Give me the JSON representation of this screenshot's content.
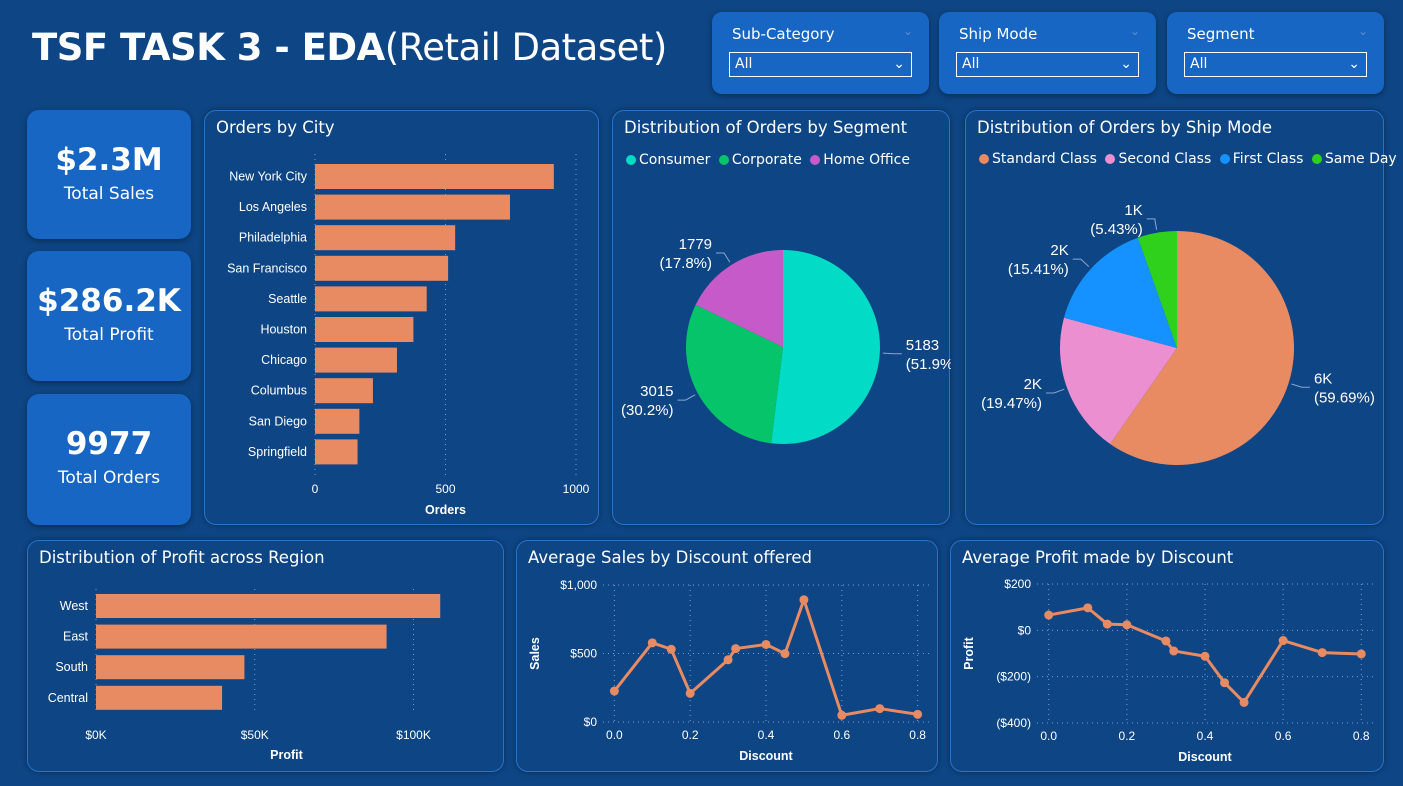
{
  "header": {
    "title_bold": "TSF TASK 3 - EDA",
    "title_light": "(Retail Dataset)"
  },
  "slicers": [
    {
      "label": "Sub-Category",
      "value": "All"
    },
    {
      "label": "Ship Mode",
      "value": "All"
    },
    {
      "label": "Segment",
      "value": "All"
    }
  ],
  "kpis": [
    {
      "value": "$2.3M",
      "label": "Total Sales"
    },
    {
      "value": "$286.2K",
      "label": "Total Profit"
    },
    {
      "value": "9977",
      "label": "Total Orders"
    }
  ],
  "colors": {
    "bar": "#e98b62",
    "background": "#0e4584",
    "card": "#1766c3",
    "consumer": "#02dcc7",
    "corporate": "#05c46a",
    "home_office": "#c65ac8",
    "standard_class": "#e98b62",
    "second_class": "#ec8fd0",
    "first_class": "#1592ff",
    "same_day": "#2fd11d"
  },
  "chart_data": [
    {
      "id": "orders_by_city",
      "type": "bar",
      "orientation": "horizontal",
      "title": "Orders by City",
      "categories": [
        "New York City",
        "Los Angeles",
        "Philadelphia",
        "San Francisco",
        "Seattle",
        "Houston",
        "Chicago",
        "Columbus",
        "San Diego",
        "Springfield"
      ],
      "values": [
        915,
        747,
        537,
        510,
        428,
        377,
        314,
        222,
        170,
        163
      ],
      "xlabel": "Orders",
      "xlim": [
        0,
        1000
      ],
      "ticks": [
        "0",
        "500",
        "1000"
      ],
      "tick_values": [
        0,
        500,
        1000
      ],
      "grid": true
    },
    {
      "id": "orders_by_segment",
      "type": "pie",
      "title": "Distribution of Orders by Segment",
      "legend": [
        "Consumer",
        "Corporate",
        "Home Office"
      ],
      "values": [
        5183,
        3015,
        1779
      ],
      "labels": [
        {
          "value": "5183",
          "pct": "(51.9%)"
        },
        {
          "value": "3015",
          "pct": "(30.2%)"
        },
        {
          "value": "1779",
          "pct": "(17.8%)"
        }
      ]
    },
    {
      "id": "orders_by_ship_mode",
      "type": "pie",
      "title": "Distribution of Orders by Ship Mode",
      "legend": [
        "Standard Class",
        "Second Class",
        "First Class",
        "Same Day"
      ],
      "values": [
        59.69,
        19.47,
        15.41,
        5.43
      ],
      "labels": [
        {
          "value": "6K",
          "pct": "(59.69%)"
        },
        {
          "value": "2K",
          "pct": "(19.47%)"
        },
        {
          "value": "2K",
          "pct": "(15.41%)"
        },
        {
          "value": "1K",
          "pct": "(5.43%)"
        }
      ]
    },
    {
      "id": "profit_by_region",
      "type": "bar",
      "orientation": "horizontal",
      "title": "Distribution of Profit across Region",
      "categories": [
        "West",
        "East",
        "South",
        "Central"
      ],
      "values": [
        108418,
        91522,
        46749,
        39706
      ],
      "xlabel": "Profit",
      "xlim": [
        0,
        120000
      ],
      "ticks": [
        "$0K",
        "$50K",
        "$100K"
      ],
      "tick_values": [
        0,
        50000,
        100000
      ],
      "grid": true
    },
    {
      "id": "avg_sales_by_discount",
      "type": "line",
      "title": "Average Sales by Discount offered",
      "x": [
        0,
        0.1,
        0.15,
        0.2,
        0.3,
        0.32,
        0.4,
        0.45,
        0.5,
        0.6,
        0.7,
        0.8
      ],
      "y": [
        226,
        578,
        531,
        209,
        454,
        536,
        566,
        499,
        892,
        49,
        98,
        56
      ],
      "xlabel": "Discount",
      "ylabel": "Sales",
      "ylim": [
        0,
        1000
      ],
      "xlim": [
        -0.03,
        0.83
      ],
      "xticks": [
        "0.0",
        "0.2",
        "0.4",
        "0.6",
        "0.8"
      ],
      "xtick_values": [
        0,
        0.2,
        0.4,
        0.6,
        0.8
      ],
      "yticks": [
        "$0",
        "$500",
        "$1,000"
      ],
      "ytick_values": [
        0,
        500,
        1000
      ],
      "grid": true
    },
    {
      "id": "avg_profit_by_discount",
      "type": "line",
      "title": "Average Profit made by Discount",
      "x": [
        0,
        0.1,
        0.15,
        0.2,
        0.3,
        0.32,
        0.4,
        0.45,
        0.5,
        0.6,
        0.7,
        0.8
      ],
      "y": [
        66,
        97,
        27,
        24,
        -46,
        -89,
        -112,
        -226,
        -311,
        -44,
        -96,
        -102
      ],
      "xlabel": "Discount",
      "ylabel": "Profit",
      "ylim": [
        -400,
        200
      ],
      "xlim": [
        -0.03,
        0.83
      ],
      "xticks": [
        "0.0",
        "0.2",
        "0.4",
        "0.6",
        "0.8"
      ],
      "xtick_values": [
        0,
        0.2,
        0.4,
        0.6,
        0.8
      ],
      "yticks": [
        "$200",
        "$0",
        "($200)",
        "($400)"
      ],
      "ytick_values": [
        200,
        0,
        -200,
        -400
      ],
      "grid": true
    }
  ]
}
